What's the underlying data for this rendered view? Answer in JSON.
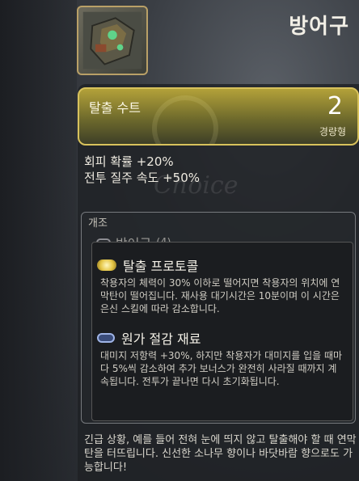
{
  "header": {
    "category": "방어구"
  },
  "item": {
    "icon": "armor-chest-icon",
    "name": "탈출 수트",
    "rank": "2",
    "weight_class": "경량형"
  },
  "stats": [
    {
      "text": "회피 확률 +20%"
    },
    {
      "text": "전투 질주 속도 +50%"
    }
  ],
  "mods": {
    "title": "개조",
    "slot_label": "방어구",
    "slot_count": "(4)",
    "items": [
      {
        "icon": "mod-gold-icon",
        "name": "탈출 프로토콜",
        "description": "착용자의 체력이 30% 이하로 떨어지면 착용자의 위치에 연막탄이 떨어집니다. 재사용 대기시간은 10분이며 이 시간은 은신 스킬에 따라 감소합니다."
      },
      {
        "icon": "mod-blue-icon",
        "name": "원가 절감 재료",
        "description": "대미지 저항력 +30%, 하지만 착용자가 대미지를 입을 때마다 5%씩 감소하여 추가 보너스가 완전히 사라질 때까지 계속됩니다. 전투가 끝나면 다시 초기화됩니다."
      }
    ]
  },
  "flavor": "긴급 상황, 예를 들어 전혀 눈에 띄지 않고 탈출해야 할 때 연막탄을 터뜨립니다. 신선한 소나무 향이나 바닷바람 향으로도 가능합니다!",
  "colors": {
    "gold_accent": "#d8c25c",
    "panel_bg": "#1e2125"
  }
}
